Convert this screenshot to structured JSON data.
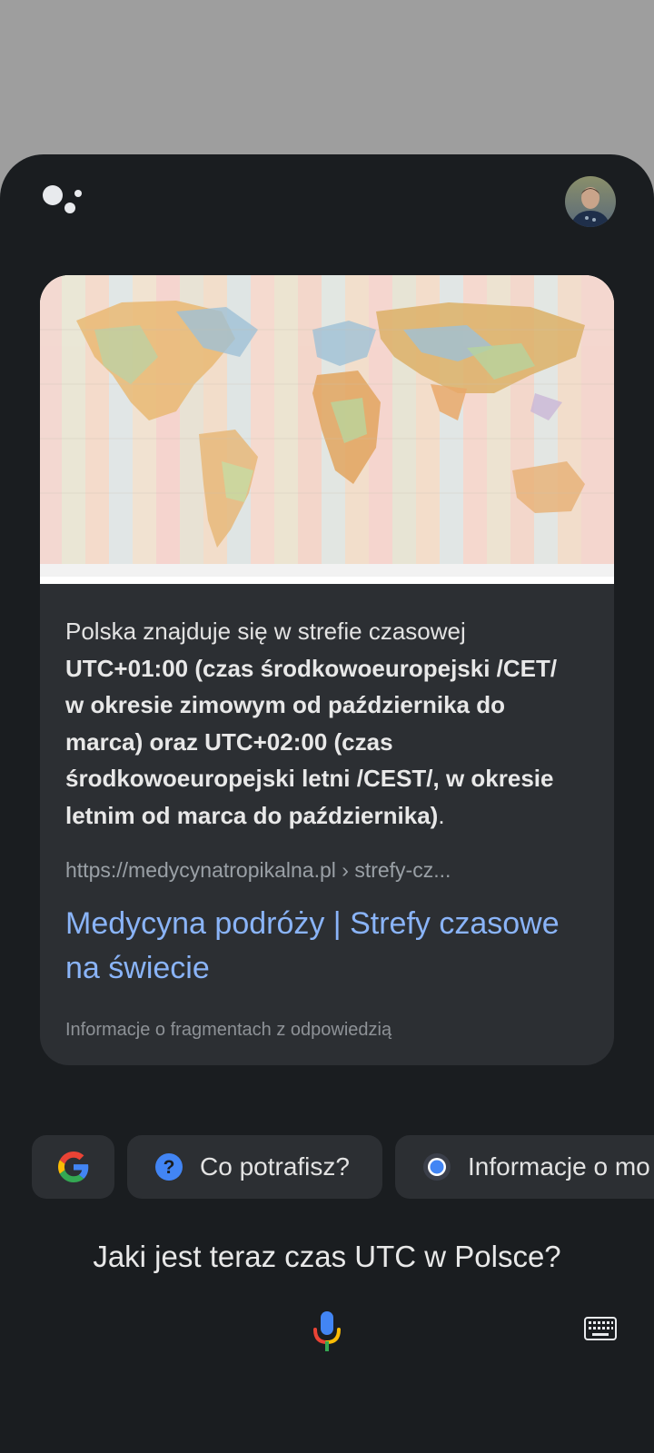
{
  "assistant": {
    "logo_icon": "google-assistant-dots-icon",
    "avatar_icon": "user-avatar"
  },
  "card": {
    "image_icon": "world-time-zones-map",
    "snippet": {
      "intro": "Polska znajduje się w strefie czasowej ",
      "bold": "UTC+01:00 (czas środkowoeuropejski /CET/ w okresie zimowym od października do marca) oraz UTC+02:00 (czas środkowoeuropejski letni /CEST/, w okresie letnim od marca do października)",
      "end": "."
    },
    "source_url": "https://medycynatropikalna.pl › strefy-cz...",
    "title": "Medycyna podróży | Strefy czasowe na świecie",
    "snippet_info": "Informacje o fragmentach z odpowiedzią"
  },
  "chips": [
    {
      "label": "",
      "icon": "google-g-icon"
    },
    {
      "label": "Co potrafisz?",
      "icon": "help-circle-icon"
    },
    {
      "label": "Informacje o mo",
      "icon": "record-dot-icon"
    }
  ],
  "query": "Jaki jest teraz czas UTC w Polsce?",
  "input": {
    "mic_icon": "microphone-icon",
    "keyboard_icon": "keyboard-icon"
  },
  "colors": {
    "sheet_bg": "#1a1d20",
    "card_bg": "#2c2f33",
    "link": "#8ab4f8",
    "scrim": "#9e9e9e"
  }
}
